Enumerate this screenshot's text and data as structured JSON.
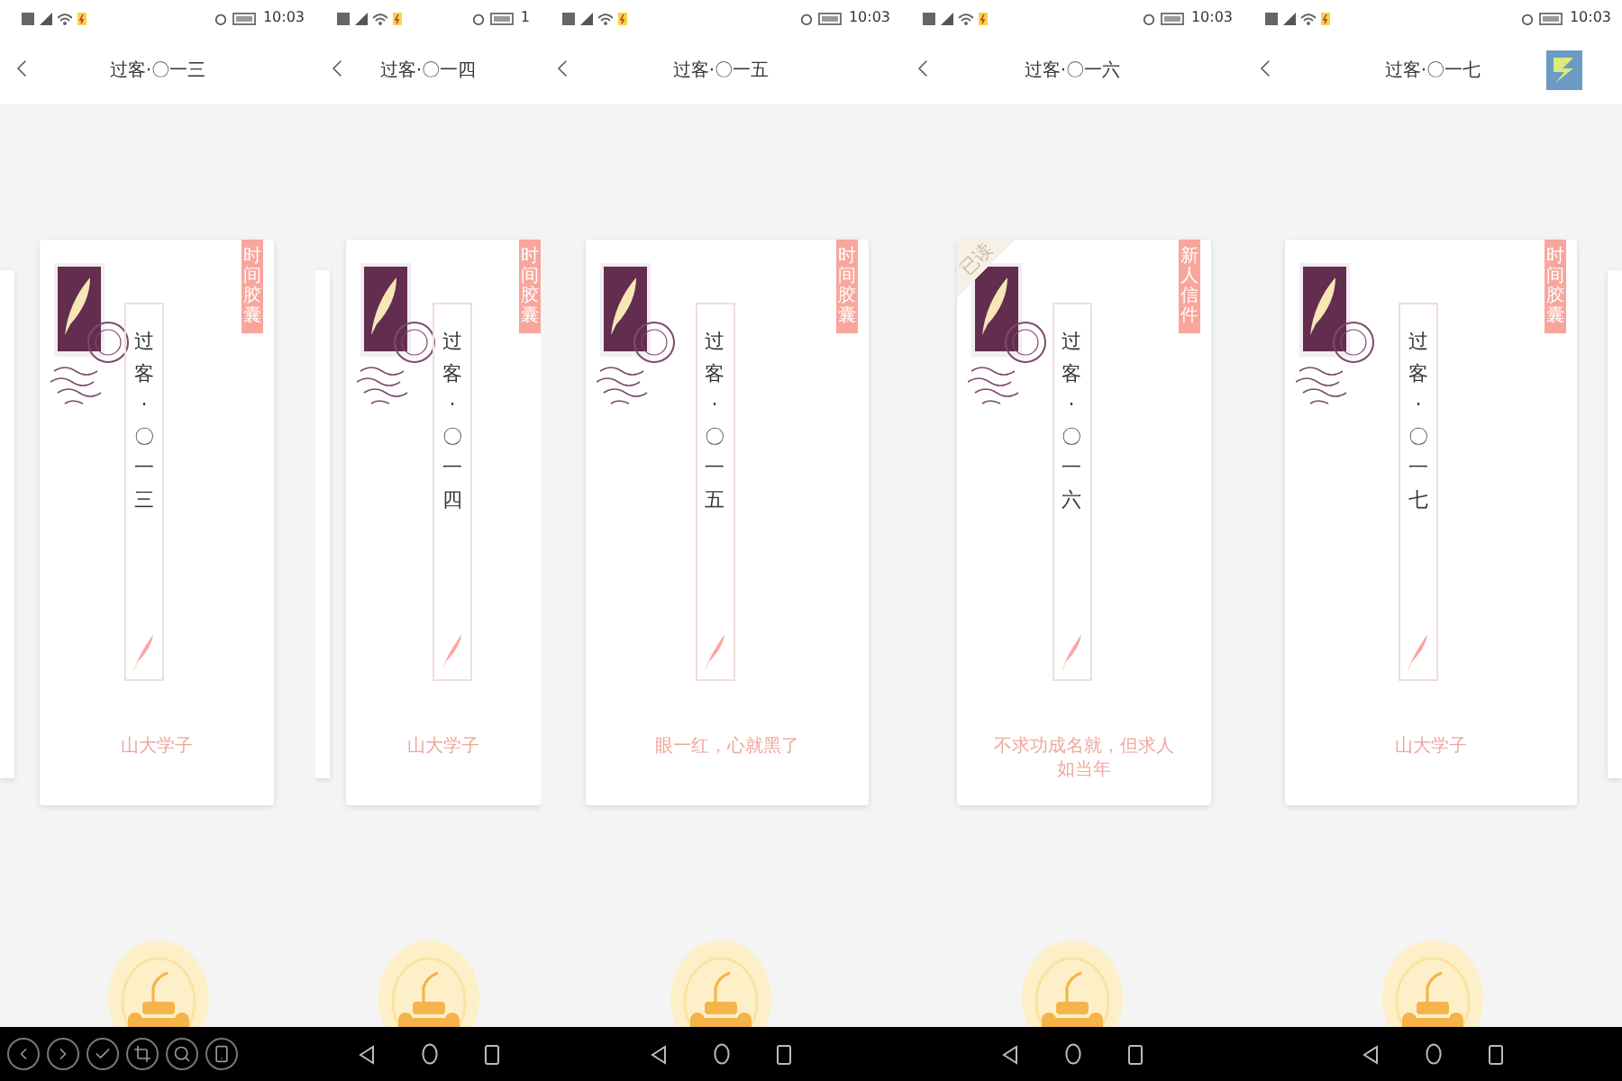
{
  "panes": [
    {
      "status": {
        "time": "10:03"
      },
      "title": "过客·〇一三",
      "card": {
        "tag": "时间胶囊",
        "title": "过客·〇一三",
        "footer": "山大学子"
      },
      "nav": {
        "kind": "toolbar"
      }
    },
    {
      "status": {
        "time": "1"
      },
      "title": "过客·〇一四",
      "card": {
        "tag": "时间胶囊",
        "title": "过客·〇一四",
        "footer": "山大学子"
      },
      "nav": {
        "kind": "system"
      }
    },
    {
      "status": {
        "time": "10:03"
      },
      "title": "过客·〇一五",
      "card": {
        "tag": "时间胶囊",
        "title": "过客·〇一五",
        "footer": "眼一红，心就黑了"
      },
      "nav": {
        "kind": "system"
      }
    },
    {
      "status": {
        "time": "10:03"
      },
      "title": "过客·〇一六",
      "card": {
        "tag": "新人信件",
        "title": "过客·〇一六",
        "footer": "不求功成名就，但求人如当年",
        "read_label": "已读"
      },
      "nav": {
        "kind": "system"
      }
    },
    {
      "status": {
        "time": "10:03"
      },
      "title": "过客·〇一七",
      "card": {
        "tag": "时间胶囊",
        "title": "过客·〇一七",
        "footer": "山大学子"
      },
      "nav": {
        "kind": "system"
      },
      "shortcut_icon": true
    }
  ]
}
